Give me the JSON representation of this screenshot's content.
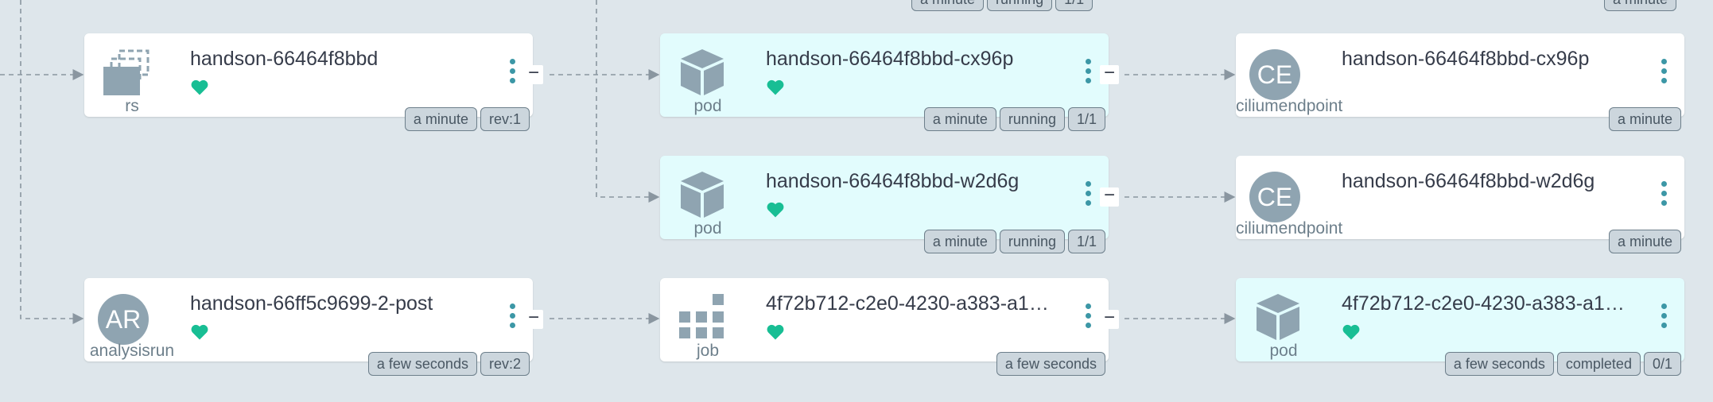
{
  "nodes": [
    {
      "title": "handson-66464f8bbd",
      "kind": "rs",
      "tags": [
        "a minute",
        "rev:1"
      ]
    },
    {
      "title": "handson-66464f8bbd-cx96p",
      "kind": "pod",
      "tags": [
        "a minute",
        "running",
        "1/1"
      ]
    },
    {
      "title": "handson-66464f8bbd-cx96p",
      "kind": "ciliumendpoint",
      "badge": "CE",
      "tags": [
        "a minute"
      ]
    },
    {
      "title": "handson-66464f8bbd-w2d6g",
      "kind": "pod",
      "tags": [
        "a minute",
        "running",
        "1/1"
      ]
    },
    {
      "title": "handson-66464f8bbd-w2d6g",
      "kind": "ciliumendpoint",
      "badge": "CE",
      "tags": [
        "a minute"
      ]
    },
    {
      "title": "handson-66ff5c9699-2-post",
      "kind": "analysisrun",
      "badge": "AR",
      "tags": [
        "a few seconds",
        "rev:2"
      ]
    },
    {
      "title": "4f72b712-c2e0-4230-a383-a1…",
      "kind": "job",
      "tags": [
        "a few seconds"
      ]
    },
    {
      "title": "4f72b712-c2e0-4230-a383-a1…",
      "kind": "pod",
      "tags": [
        "a few seconds",
        "completed",
        "0/1"
      ]
    }
  ],
  "offscreen_tags": {
    "middle": [
      "a minute",
      "running",
      "1/1"
    ],
    "right": [
      "a minute"
    ]
  },
  "collapse_label": "−",
  "colors": {
    "background": "#dee6eb",
    "healthy": "#18be94",
    "pod_tint": "#e2fcfd",
    "icon_gray": "#8fa4b1",
    "menu_teal": "#3c97a6",
    "edge": "#8a96a0"
  },
  "icons": {
    "rs": "stacked-windows-icon",
    "pod": "cube-icon",
    "job": "grid-blocks-icon",
    "health": "heart-icon",
    "menu": "vertical-ellipsis-icon"
  }
}
